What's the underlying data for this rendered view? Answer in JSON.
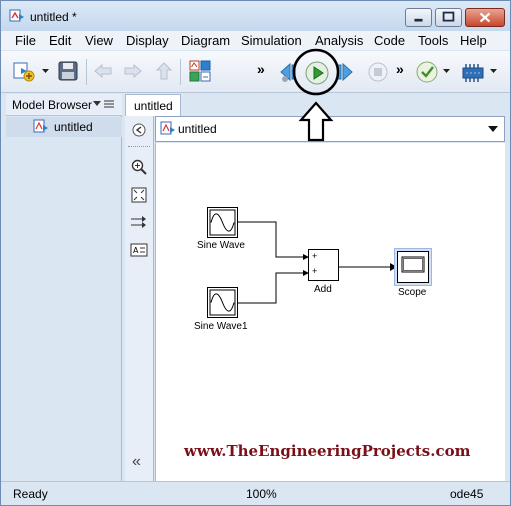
{
  "window": {
    "title": "untitled *"
  },
  "menu": [
    "File",
    "Edit",
    "View",
    "Display",
    "Diagram",
    "Simulation",
    "Analysis",
    "Code",
    "Tools",
    "Help"
  ],
  "toolbar": {
    "overflow_1": "»",
    "overflow_2": "»",
    "overflow_3": "»"
  },
  "model_browser": {
    "title": "Model Browser",
    "items": [
      "untitled"
    ]
  },
  "tabs": [
    "untitled"
  ],
  "address": {
    "model": "untitled"
  },
  "diagram": {
    "blocks": {
      "sine1": "Sine Wave",
      "sine2": "Sine Wave1",
      "add": "Add",
      "scope": "Scope",
      "plus1": "+",
      "plus2": "+"
    }
  },
  "watermark": "www.TheEngineeringProjects.com",
  "palette": {
    "collapse": "«"
  },
  "status": {
    "state": "Ready",
    "zoom": "100%",
    "solver": "ode45"
  },
  "colors": {
    "run_button": "#2e9e2e",
    "annotation": "#000000",
    "watermark": "#7a1017"
  }
}
